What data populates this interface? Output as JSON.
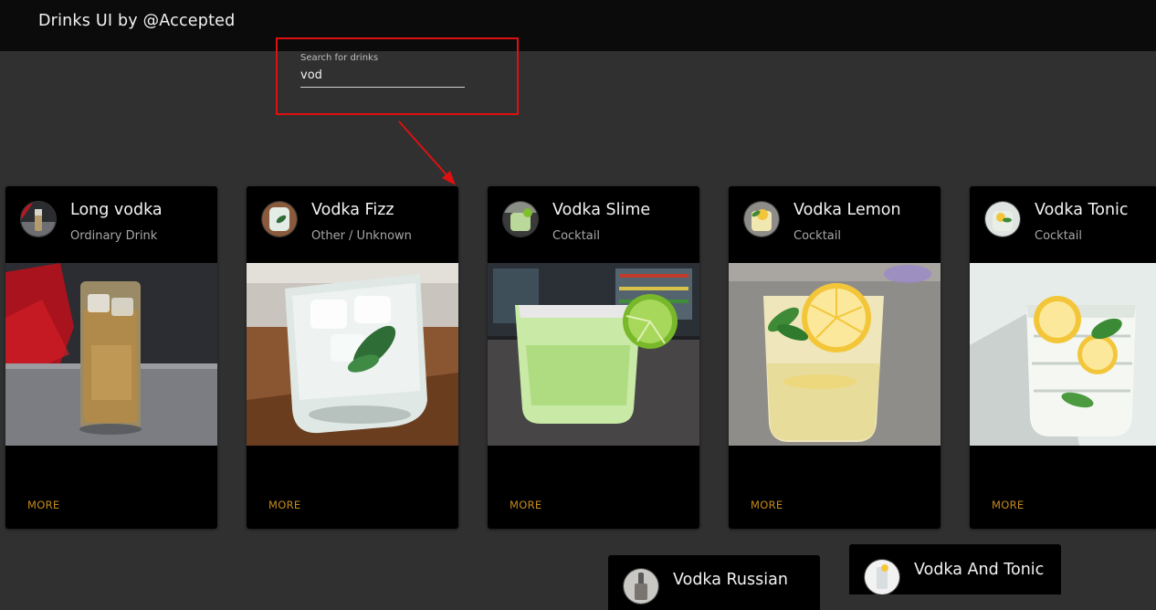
{
  "header": {
    "title": "Drinks UI by @Accepted"
  },
  "search": {
    "label": "Search for drinks",
    "value": "vod"
  },
  "colors": {
    "accent_more": "#c48a1c",
    "annotation_red": "#e01010",
    "background": "#303030",
    "topbar": "#0b0b0c",
    "card": "#000000"
  },
  "drinks": [
    {
      "name": "Long vodka",
      "category": "Ordinary Drink",
      "action": "MORE"
    },
    {
      "name": "Vodka Fizz",
      "category": "Other / Unknown",
      "action": "MORE"
    },
    {
      "name": "Vodka Slime",
      "category": "Cocktail",
      "action": "MORE"
    },
    {
      "name": "Vodka Lemon",
      "category": "Cocktail",
      "action": "MORE"
    },
    {
      "name": "Vodka Tonic",
      "category": "Cocktail",
      "action": "MORE"
    }
  ],
  "drinks_row2": [
    {
      "name": "Vodka Russian"
    },
    {
      "name": "Vodka And Tonic"
    }
  ]
}
